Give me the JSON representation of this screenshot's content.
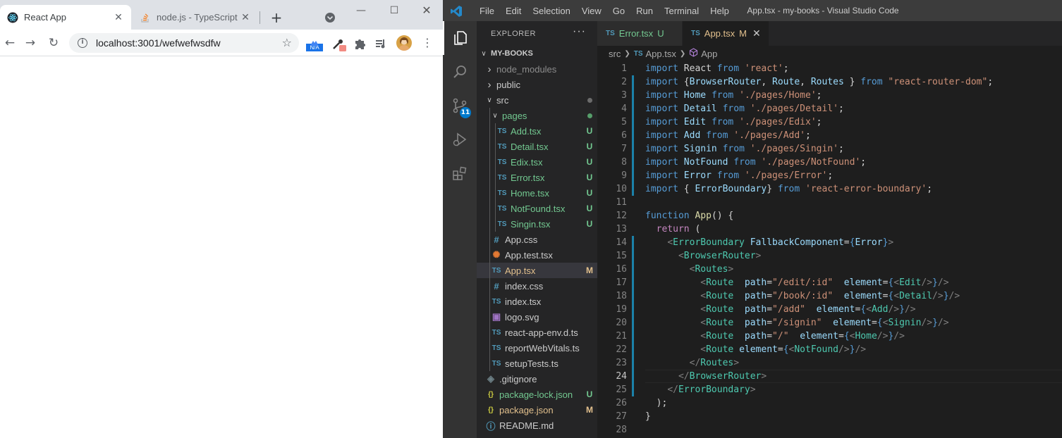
{
  "browser": {
    "tabs": [
      {
        "title": "React App",
        "active": true
      },
      {
        "title": "node.js - TypeScript S",
        "active": false
      }
    ],
    "new_tab": "+",
    "url": "localhost:3001/wefwefwsdfw",
    "ext_badge": "N/A"
  },
  "vscode": {
    "menu": [
      "File",
      "Edit",
      "Selection",
      "View",
      "Go",
      "Run",
      "Terminal",
      "Help"
    ],
    "window_title": "App.tsx - my-books - Visual Studio Code",
    "scm_badge": "11",
    "explorer": {
      "header": "EXPLORER",
      "more": "···",
      "root": "MY-BOOKS",
      "items": [
        {
          "label": "node_modules",
          "kind": "folder",
          "open": false,
          "depth": 1,
          "color": "#8c8c8c",
          "status": ""
        },
        {
          "label": "public",
          "kind": "folder",
          "open": false,
          "depth": 1,
          "color": "#cccccc",
          "status": ""
        },
        {
          "label": "src",
          "kind": "folder",
          "open": true,
          "depth": 1,
          "color": "#cccccc",
          "status": "dot-gray"
        },
        {
          "label": "pages",
          "kind": "folder",
          "open": true,
          "depth": 2,
          "color": "#73c991",
          "status": "dot-green"
        },
        {
          "label": "Add.tsx",
          "kind": "ts",
          "depth": 3,
          "color": "#73c991",
          "status": "U"
        },
        {
          "label": "Detail.tsx",
          "kind": "ts",
          "depth": 3,
          "color": "#73c991",
          "status": "U"
        },
        {
          "label": "Edix.tsx",
          "kind": "ts",
          "depth": 3,
          "color": "#73c991",
          "status": "U"
        },
        {
          "label": "Error.tsx",
          "kind": "ts",
          "depth": 3,
          "color": "#73c991",
          "status": "U"
        },
        {
          "label": "Home.tsx",
          "kind": "ts",
          "depth": 3,
          "color": "#73c991",
          "status": "U"
        },
        {
          "label": "NotFound.tsx",
          "kind": "ts",
          "depth": 3,
          "color": "#73c991",
          "status": "U"
        },
        {
          "label": "Singin.tsx",
          "kind": "ts",
          "depth": 3,
          "color": "#73c991",
          "status": "U"
        },
        {
          "label": "App.css",
          "kind": "css",
          "depth": 2,
          "color": "#cccccc",
          "status": ""
        },
        {
          "label": "App.test.tsx",
          "kind": "test",
          "depth": 2,
          "color": "#cccccc",
          "status": ""
        },
        {
          "label": "App.tsx",
          "kind": "ts",
          "depth": 2,
          "color": "#e2c08d",
          "status": "M",
          "selected": true
        },
        {
          "label": "index.css",
          "kind": "css",
          "depth": 2,
          "color": "#cccccc",
          "status": ""
        },
        {
          "label": "index.tsx",
          "kind": "ts",
          "depth": 2,
          "color": "#cccccc",
          "status": ""
        },
        {
          "label": "logo.svg",
          "kind": "svg",
          "depth": 2,
          "color": "#cccccc",
          "status": ""
        },
        {
          "label": "react-app-env.d.ts",
          "kind": "ts",
          "depth": 2,
          "color": "#cccccc",
          "status": ""
        },
        {
          "label": "reportWebVitals.ts",
          "kind": "ts",
          "depth": 2,
          "color": "#cccccc",
          "status": ""
        },
        {
          "label": "setupTests.ts",
          "kind": "ts",
          "depth": 2,
          "color": "#cccccc",
          "status": ""
        },
        {
          "label": ".gitignore",
          "kind": "git",
          "depth": 1,
          "color": "#cccccc",
          "status": ""
        },
        {
          "label": "package-lock.json",
          "kind": "json",
          "depth": 1,
          "color": "#73c991",
          "status": "U"
        },
        {
          "label": "package.json",
          "kind": "json",
          "depth": 1,
          "color": "#e2c08d",
          "status": "M"
        },
        {
          "label": "README.md",
          "kind": "info",
          "depth": 1,
          "color": "#cccccc",
          "status": ""
        }
      ]
    },
    "editor_tabs": [
      {
        "label": "Error.tsx",
        "status": "U",
        "color": "#73c991",
        "active": false
      },
      {
        "label": "App.tsx",
        "status": "M",
        "color": "#e2c08d",
        "active": true
      }
    ],
    "breadcrumbs": [
      "src",
      "App.tsx",
      "App"
    ],
    "current_line": 24,
    "modified_lines": [
      [
        2,
        10
      ],
      [
        14,
        25
      ]
    ],
    "code": [
      [
        [
          "k",
          "import "
        ],
        [
          "p",
          "React "
        ],
        [
          "k",
          "from "
        ],
        [
          "s",
          "'react'"
        ],
        [
          "p",
          ";"
        ]
      ],
      [
        [
          "k",
          "import "
        ],
        [
          "p",
          "{"
        ],
        [
          "v",
          "BrowserRouter"
        ],
        [
          "p",
          ", "
        ],
        [
          "v",
          "Route"
        ],
        [
          "p",
          ", "
        ],
        [
          "v",
          "Routes"
        ],
        [
          "p",
          " } "
        ],
        [
          "k",
          "from "
        ],
        [
          "s",
          "\"react-router-dom\""
        ],
        [
          "p",
          ";"
        ]
      ],
      [
        [
          "k",
          "import "
        ],
        [
          "v",
          "Home "
        ],
        [
          "k",
          "from "
        ],
        [
          "s",
          "'./pages/Home'"
        ],
        [
          "p",
          ";"
        ]
      ],
      [
        [
          "k",
          "import "
        ],
        [
          "v",
          "Detail "
        ],
        [
          "k",
          "from "
        ],
        [
          "s",
          "'./pages/Detail'"
        ],
        [
          "p",
          ";"
        ]
      ],
      [
        [
          "k",
          "import "
        ],
        [
          "v",
          "Edit "
        ],
        [
          "k",
          "from "
        ],
        [
          "s",
          "'./pages/Edix'"
        ],
        [
          "p",
          ";"
        ]
      ],
      [
        [
          "k",
          "import "
        ],
        [
          "v",
          "Add "
        ],
        [
          "k",
          "from "
        ],
        [
          "s",
          "'./pages/Add'"
        ],
        [
          "p",
          ";"
        ]
      ],
      [
        [
          "k",
          "import "
        ],
        [
          "v",
          "Signin "
        ],
        [
          "k",
          "from "
        ],
        [
          "s",
          "'./pages/Singin'"
        ],
        [
          "p",
          ";"
        ]
      ],
      [
        [
          "k",
          "import "
        ],
        [
          "v",
          "NotFound "
        ],
        [
          "k",
          "from "
        ],
        [
          "s",
          "'./pages/NotFound'"
        ],
        [
          "p",
          ";"
        ]
      ],
      [
        [
          "k",
          "import "
        ],
        [
          "v",
          "Error "
        ],
        [
          "k",
          "from "
        ],
        [
          "s",
          "'./pages/Error'"
        ],
        [
          "p",
          ";"
        ]
      ],
      [
        [
          "k",
          "import "
        ],
        [
          "p",
          "{ "
        ],
        [
          "v",
          "ErrorBoundary"
        ],
        [
          "p",
          "} "
        ],
        [
          "k",
          "from "
        ],
        [
          "s",
          "'react-error-boundary'"
        ],
        [
          "p",
          ";"
        ]
      ],
      [],
      [
        [
          "k",
          "function "
        ],
        [
          "f",
          "App"
        ],
        [
          "p",
          "() {"
        ]
      ],
      [
        [
          "p",
          "  "
        ],
        [
          "kw",
          "return "
        ],
        [
          "p",
          "("
        ]
      ],
      [
        [
          "p",
          "    "
        ],
        [
          "b",
          "<"
        ],
        [
          "t",
          "ErrorBoundary "
        ],
        [
          "v",
          "FallbackComponent"
        ],
        [
          "p",
          "="
        ],
        [
          "k",
          "{"
        ],
        [
          "v",
          "Error"
        ],
        [
          "k",
          "}"
        ],
        [
          "b",
          ">"
        ]
      ],
      [
        [
          "p",
          "      "
        ],
        [
          "b",
          "<"
        ],
        [
          "t",
          "BrowserRouter"
        ],
        [
          "b",
          ">"
        ]
      ],
      [
        [
          "p",
          "        "
        ],
        [
          "b",
          "<"
        ],
        [
          "t",
          "Routes"
        ],
        [
          "b",
          ">"
        ]
      ],
      [
        [
          "p",
          "          "
        ],
        [
          "b",
          "<"
        ],
        [
          "t",
          "Route  "
        ],
        [
          "v",
          "path"
        ],
        [
          "p",
          "="
        ],
        [
          "s",
          "\"/edit/:id\""
        ],
        [
          "p",
          "  "
        ],
        [
          "v",
          "element"
        ],
        [
          "p",
          "="
        ],
        [
          "k",
          "{"
        ],
        [
          "b",
          "<"
        ],
        [
          "t",
          "Edit"
        ],
        [
          "b",
          "/>"
        ],
        [
          "k",
          "}"
        ],
        [
          "b",
          "/>"
        ]
      ],
      [
        [
          "p",
          "          "
        ],
        [
          "b",
          "<"
        ],
        [
          "t",
          "Route  "
        ],
        [
          "v",
          "path"
        ],
        [
          "p",
          "="
        ],
        [
          "s",
          "\"/book/:id\""
        ],
        [
          "p",
          "  "
        ],
        [
          "v",
          "element"
        ],
        [
          "p",
          "="
        ],
        [
          "k",
          "{"
        ],
        [
          "b",
          "<"
        ],
        [
          "t",
          "Detail"
        ],
        [
          "b",
          "/>"
        ],
        [
          "k",
          "}"
        ],
        [
          "b",
          "/>"
        ]
      ],
      [
        [
          "p",
          "          "
        ],
        [
          "b",
          "<"
        ],
        [
          "t",
          "Route  "
        ],
        [
          "v",
          "path"
        ],
        [
          "p",
          "="
        ],
        [
          "s",
          "\"/add\""
        ],
        [
          "p",
          "  "
        ],
        [
          "v",
          "element"
        ],
        [
          "p",
          "="
        ],
        [
          "k",
          "{"
        ],
        [
          "b",
          "<"
        ],
        [
          "t",
          "Add"
        ],
        [
          "b",
          "/>"
        ],
        [
          "k",
          "}"
        ],
        [
          "b",
          "/>"
        ]
      ],
      [
        [
          "p",
          "          "
        ],
        [
          "b",
          "<"
        ],
        [
          "t",
          "Route  "
        ],
        [
          "v",
          "path"
        ],
        [
          "p",
          "="
        ],
        [
          "s",
          "\"/signin\""
        ],
        [
          "p",
          "  "
        ],
        [
          "v",
          "element"
        ],
        [
          "p",
          "="
        ],
        [
          "k",
          "{"
        ],
        [
          "b",
          "<"
        ],
        [
          "t",
          "Signin"
        ],
        [
          "b",
          "/>"
        ],
        [
          "k",
          "}"
        ],
        [
          "b",
          "/>"
        ]
      ],
      [
        [
          "p",
          "          "
        ],
        [
          "b",
          "<"
        ],
        [
          "t",
          "Route  "
        ],
        [
          "v",
          "path"
        ],
        [
          "p",
          "="
        ],
        [
          "s",
          "\"/\""
        ],
        [
          "p",
          "  "
        ],
        [
          "v",
          "element"
        ],
        [
          "p",
          "="
        ],
        [
          "k",
          "{"
        ],
        [
          "b",
          "<"
        ],
        [
          "t",
          "Home"
        ],
        [
          "b",
          "/>"
        ],
        [
          "k",
          "}"
        ],
        [
          "b",
          "/>"
        ]
      ],
      [
        [
          "p",
          "          "
        ],
        [
          "b",
          "<"
        ],
        [
          "t",
          "Route "
        ],
        [
          "v",
          "element"
        ],
        [
          "p",
          "="
        ],
        [
          "k",
          "{"
        ],
        [
          "b",
          "<"
        ],
        [
          "t",
          "NotFound"
        ],
        [
          "b",
          "/>"
        ],
        [
          "k",
          "}"
        ],
        [
          "b",
          "/>"
        ]
      ],
      [
        [
          "p",
          "        "
        ],
        [
          "b",
          "</"
        ],
        [
          "t",
          "Routes"
        ],
        [
          "b",
          ">"
        ]
      ],
      [
        [
          "p",
          "      "
        ],
        [
          "b",
          "</"
        ],
        [
          "t",
          "BrowserRouter"
        ],
        [
          "b",
          ">"
        ]
      ],
      [
        [
          "p",
          "    "
        ],
        [
          "b",
          "</"
        ],
        [
          "t",
          "ErrorBoundary"
        ],
        [
          "b",
          ">"
        ]
      ],
      [
        [
          "p",
          "  );"
        ]
      ],
      [
        [
          "p",
          "}"
        ]
      ],
      []
    ]
  }
}
